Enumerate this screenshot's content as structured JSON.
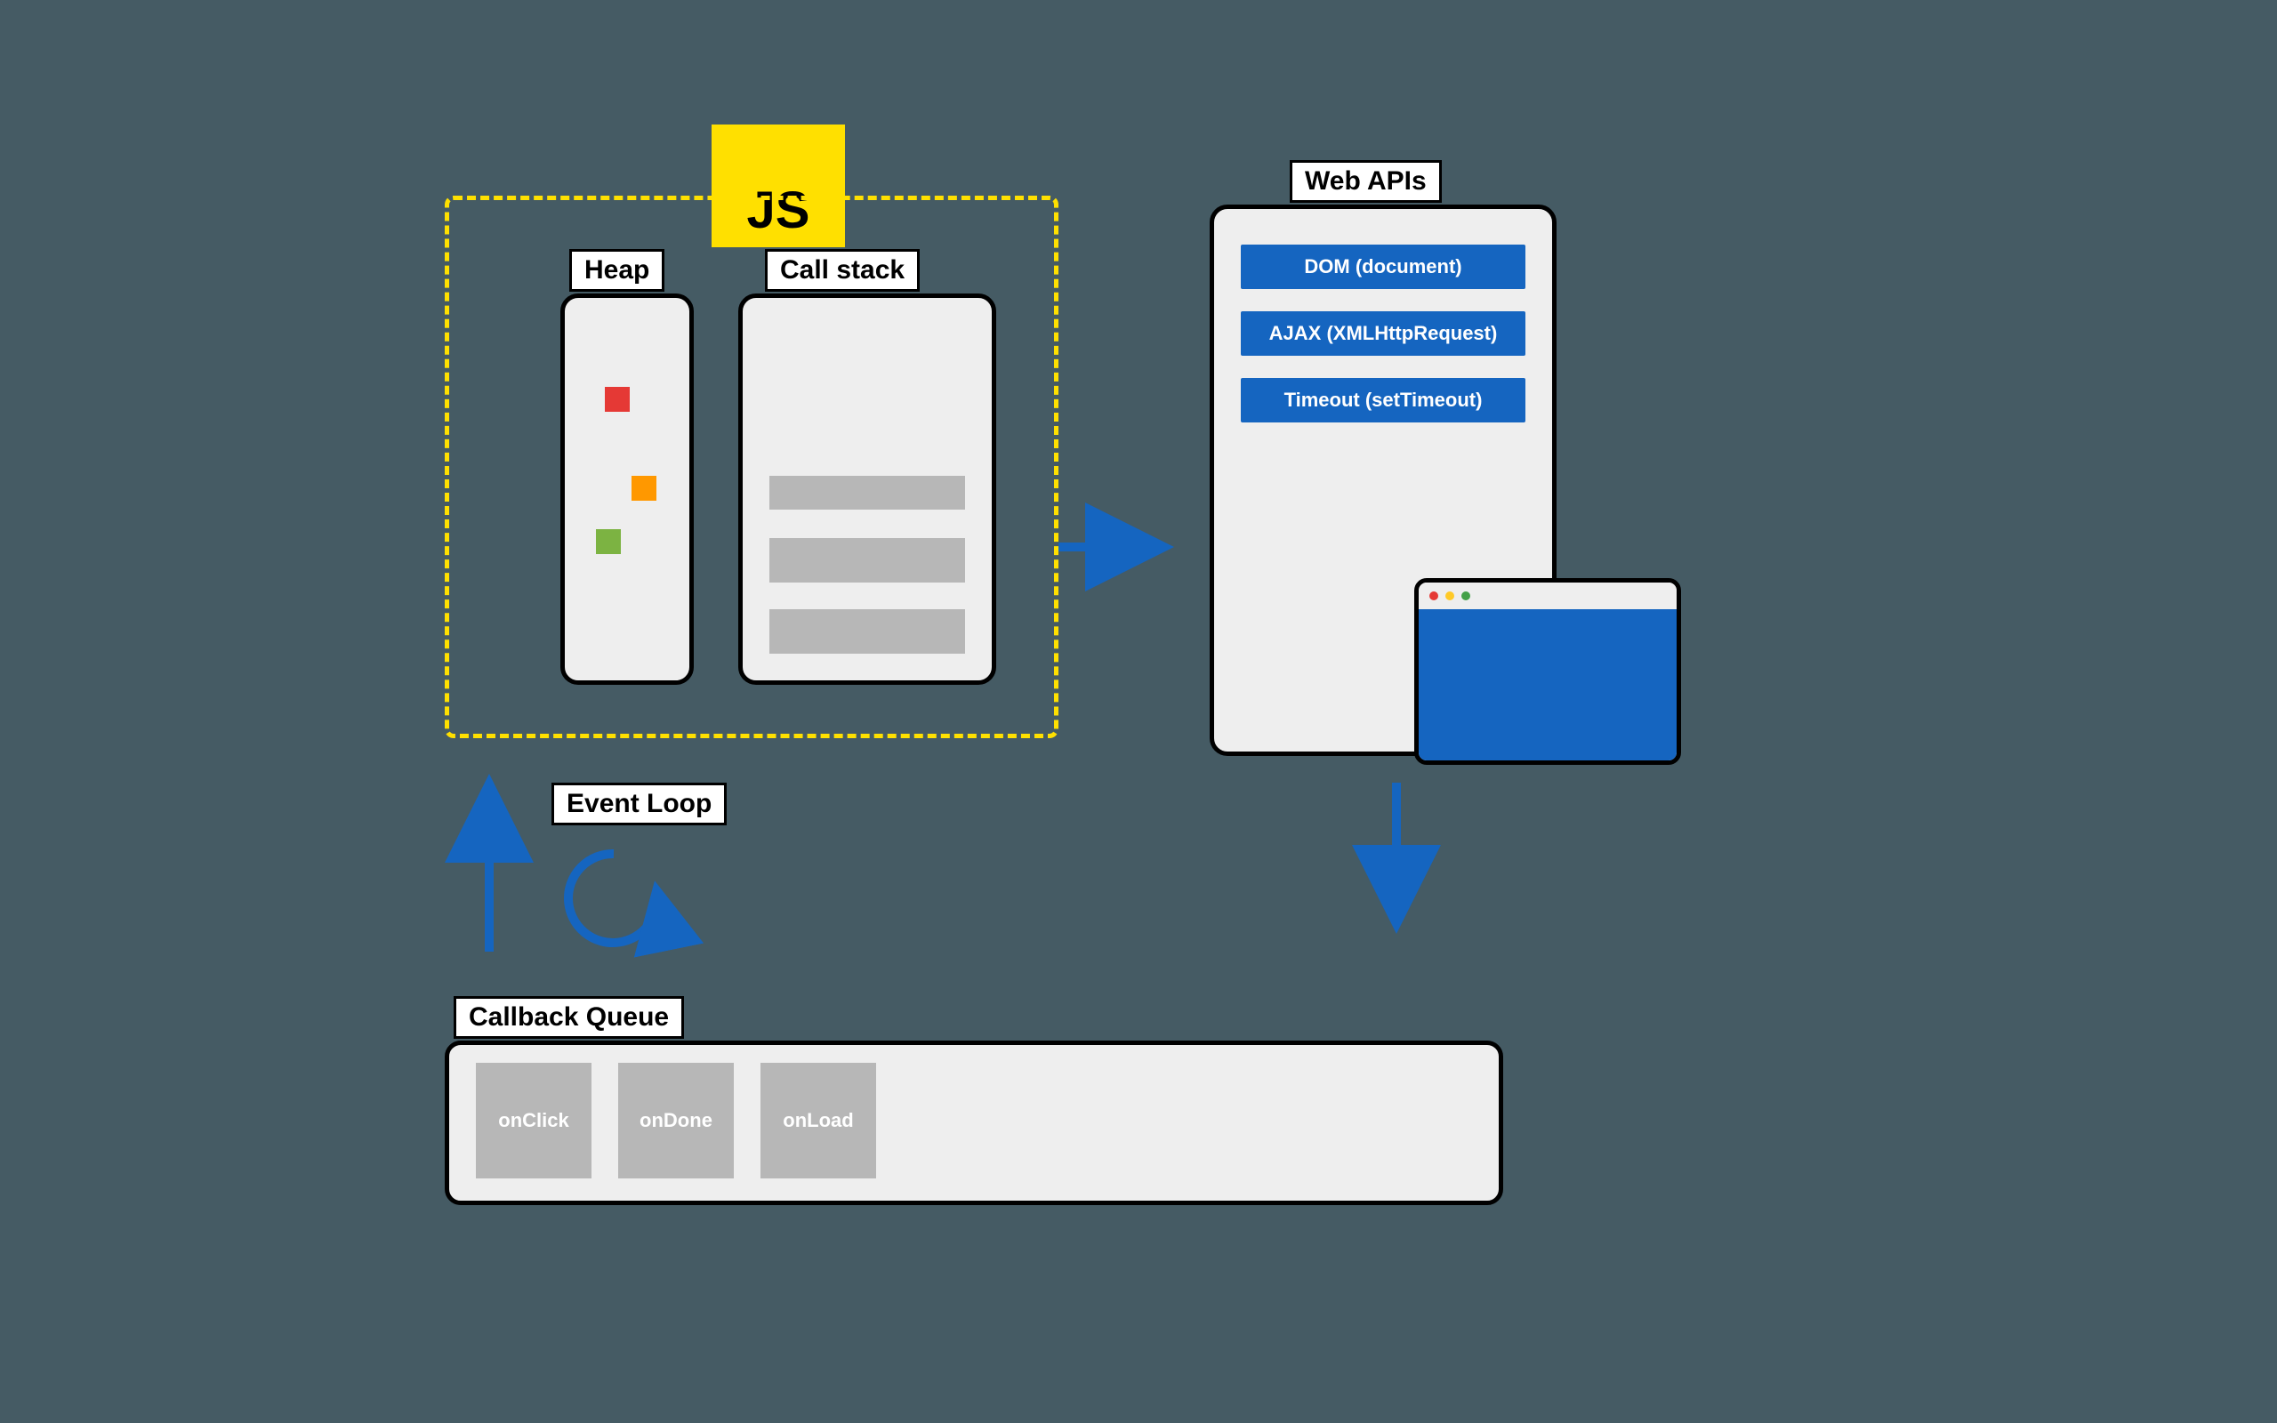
{
  "js_badge": "JS",
  "heap": {
    "label": "Heap",
    "dots": [
      "#e53935",
      "#ff9800",
      "#7cb342"
    ]
  },
  "call_stack": {
    "label": "Call stack",
    "bars": 3
  },
  "event_loop": {
    "label": "Event Loop"
  },
  "web_apis": {
    "label": "Web APIs",
    "items": [
      "DOM (document)",
      "AJAX (XMLHttpRequest)",
      "Timeout (setTimeout)"
    ],
    "browser_dots": [
      "#e53935",
      "#ffca28",
      "#43a047"
    ]
  },
  "callback_queue": {
    "label": "Callback Queue",
    "items": [
      "onClick",
      "onDone",
      "onLoad"
    ]
  },
  "colors": {
    "accent_blue": "#1565c0",
    "dashed": "#ffe000"
  }
}
